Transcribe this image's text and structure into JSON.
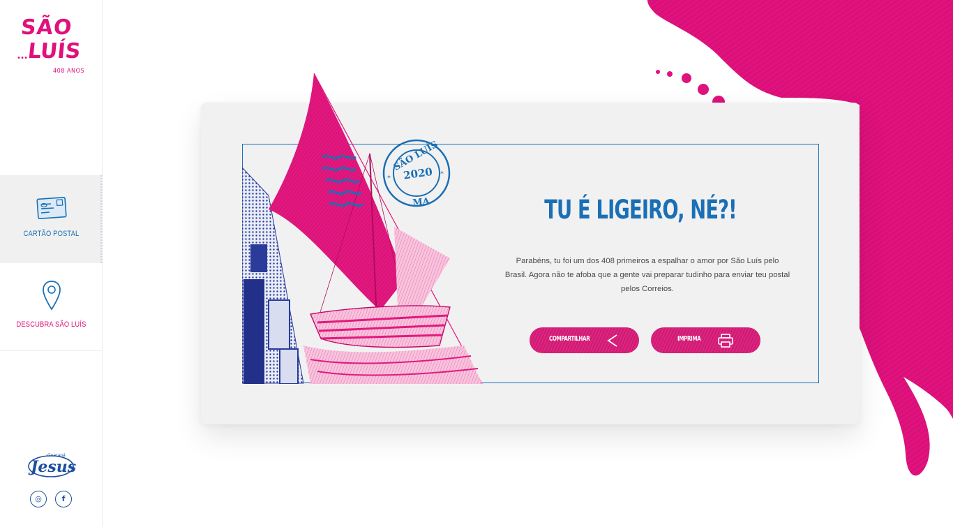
{
  "sidebar": {
    "logo": {
      "line1": "SÃO",
      "line2": "LUÍS",
      "tagline": "408 ANOS"
    },
    "items": [
      {
        "label": "CARTÃO POSTAL",
        "icon": "postcard-icon",
        "active": true
      },
      {
        "label": "DESCUBRA SÃO LUÍS",
        "icon": "map-pin-icon",
        "active": false
      }
    ],
    "brand": {
      "top": "Guaraná",
      "name": "Jesus"
    },
    "social": [
      {
        "name": "instagram",
        "glyph": "◎"
      },
      {
        "name": "facebook",
        "glyph": "f"
      }
    ]
  },
  "postcard": {
    "stamp": {
      "top": "SÃO LUÍS",
      "year": "2020",
      "bottom": "MA",
      "star": "*"
    },
    "headline": "TU É LIGEIRO, NÉ?!",
    "message": "Parabéns, tu foi um dos 408 primeiros a espalhar o amor por São Luís pelo Brasil. Agora não te afoba que a gente vai preparar tudinho para enviar teu postal pelos Correios.",
    "buttons": {
      "share": "COMPARTILHAR",
      "print": "IMPRIMA"
    }
  },
  "colors": {
    "magenta": "#e0107c",
    "blue": "#1a6fb5",
    "navy": "#1d4fa0",
    "card": "#f1f1f1"
  }
}
